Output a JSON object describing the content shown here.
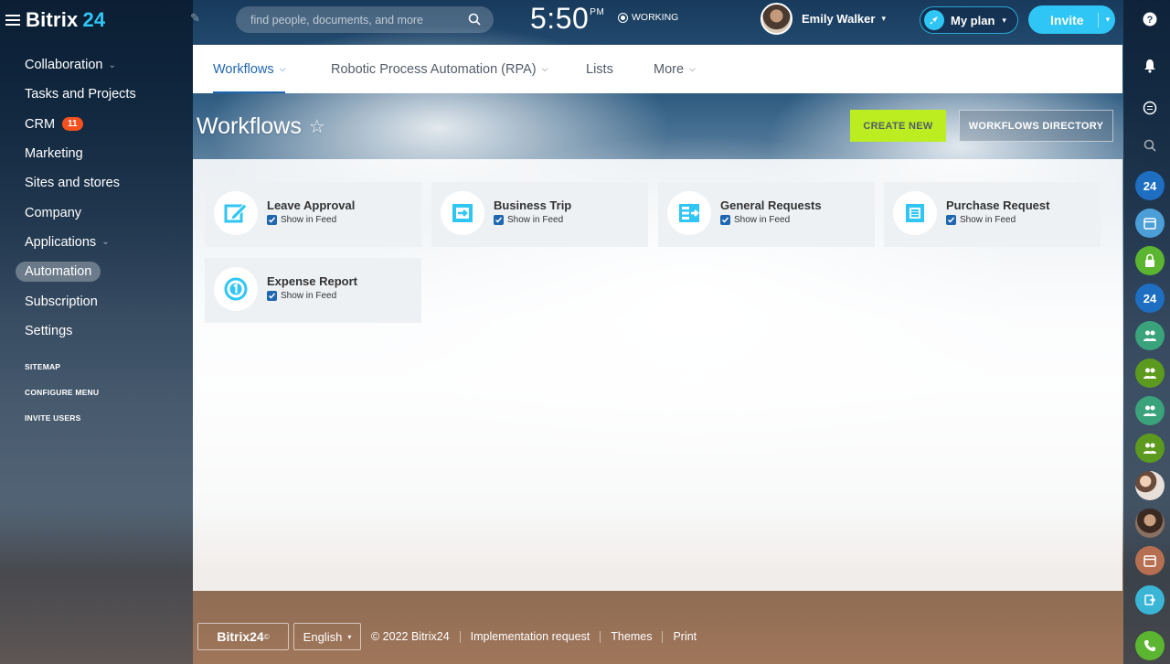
{
  "header": {
    "logo_brand": "Bitrix",
    "logo_number": "24",
    "search_placeholder": "find people, documents, and more",
    "clock_time": "5:50",
    "clock_ampm": "PM",
    "status": "WORKING",
    "user_name": "Emily Walker",
    "my_plan_label": "My plan",
    "invite_label": "Invite"
  },
  "sidebar": {
    "items": [
      {
        "label": "Collaboration"
      },
      {
        "label": "Tasks and Projects"
      },
      {
        "label": "CRM",
        "badge": "11"
      },
      {
        "label": "Marketing"
      },
      {
        "label": "Sites and stores"
      },
      {
        "label": "Company"
      },
      {
        "label": "Applications"
      },
      {
        "label": "Automation"
      },
      {
        "label": "Subscription"
      },
      {
        "label": "Settings"
      }
    ],
    "links": [
      "SITEMAP",
      "CONFIGURE MENU",
      "INVITE USERS"
    ]
  },
  "tabs": [
    {
      "label": "Workflows"
    },
    {
      "label": "Robotic Process Automation (RPA)"
    },
    {
      "label": "Lists"
    },
    {
      "label": "More"
    }
  ],
  "page": {
    "title": "Workflows",
    "create_new": "CREATE NEW",
    "directory": "WORKFLOWS DIRECTORY"
  },
  "workflows": [
    {
      "title": "Leave Approval",
      "feed_label": "Show in Feed",
      "icon": "edit-icon"
    },
    {
      "title": "Business Trip",
      "feed_label": "Show in Feed",
      "icon": "arrow-right-icon"
    },
    {
      "title": "General Requests",
      "feed_label": "Show in Feed",
      "icon": "list-icon"
    },
    {
      "title": "Purchase Request",
      "feed_label": "Show in Feed",
      "icon": "document-icon"
    },
    {
      "title": "Expense Report",
      "feed_label": "Show in Feed",
      "icon": "coin-icon"
    }
  ],
  "right_rail": {
    "badge_24": "24"
  },
  "footer": {
    "logo": "Bitrix24",
    "logo_mark": "©",
    "language": "English",
    "copyright": "© 2022 Bitrix24",
    "links": [
      "Implementation request",
      "Themes",
      "Print"
    ]
  },
  "colors": {
    "accent": "#2fc6f6",
    "primary_blue": "#2067b0",
    "create_green": "#bbed21",
    "crm_badge": "#f4511e"
  }
}
